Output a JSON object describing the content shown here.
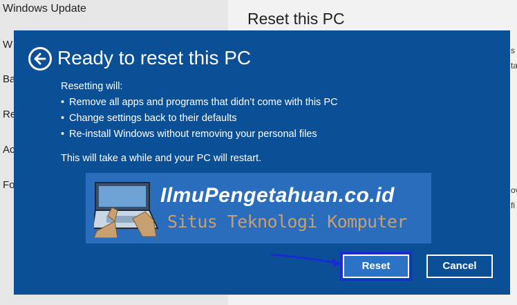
{
  "background": {
    "nav_top": "Windows Update",
    "nav_fragments": [
      "W",
      "Ba",
      "Re",
      "Ac",
      "Fo"
    ],
    "title": "Reset this PC",
    "right_fragments": [
      "s",
      "ta",
      "ov",
      "fi"
    ]
  },
  "dialog": {
    "title": "Ready to reset this PC",
    "intro": "Resetting will:",
    "bullets": [
      "Remove all apps and programs that didn’t come with this PC",
      "Change settings back to their defaults",
      "Re-install Windows without removing your personal files"
    ],
    "note": "This will take a while and your PC will restart.",
    "reset_label": "Reset",
    "cancel_label": "Cancel"
  },
  "watermark": {
    "site": "IlmuPengetahuan.co.id",
    "tagline": "Situs Teknologi Komputer"
  },
  "colors": {
    "dialog_bg": "#0b5097",
    "reset_button": "#2a73c6",
    "highlight_outline": "#1a2bd6"
  }
}
